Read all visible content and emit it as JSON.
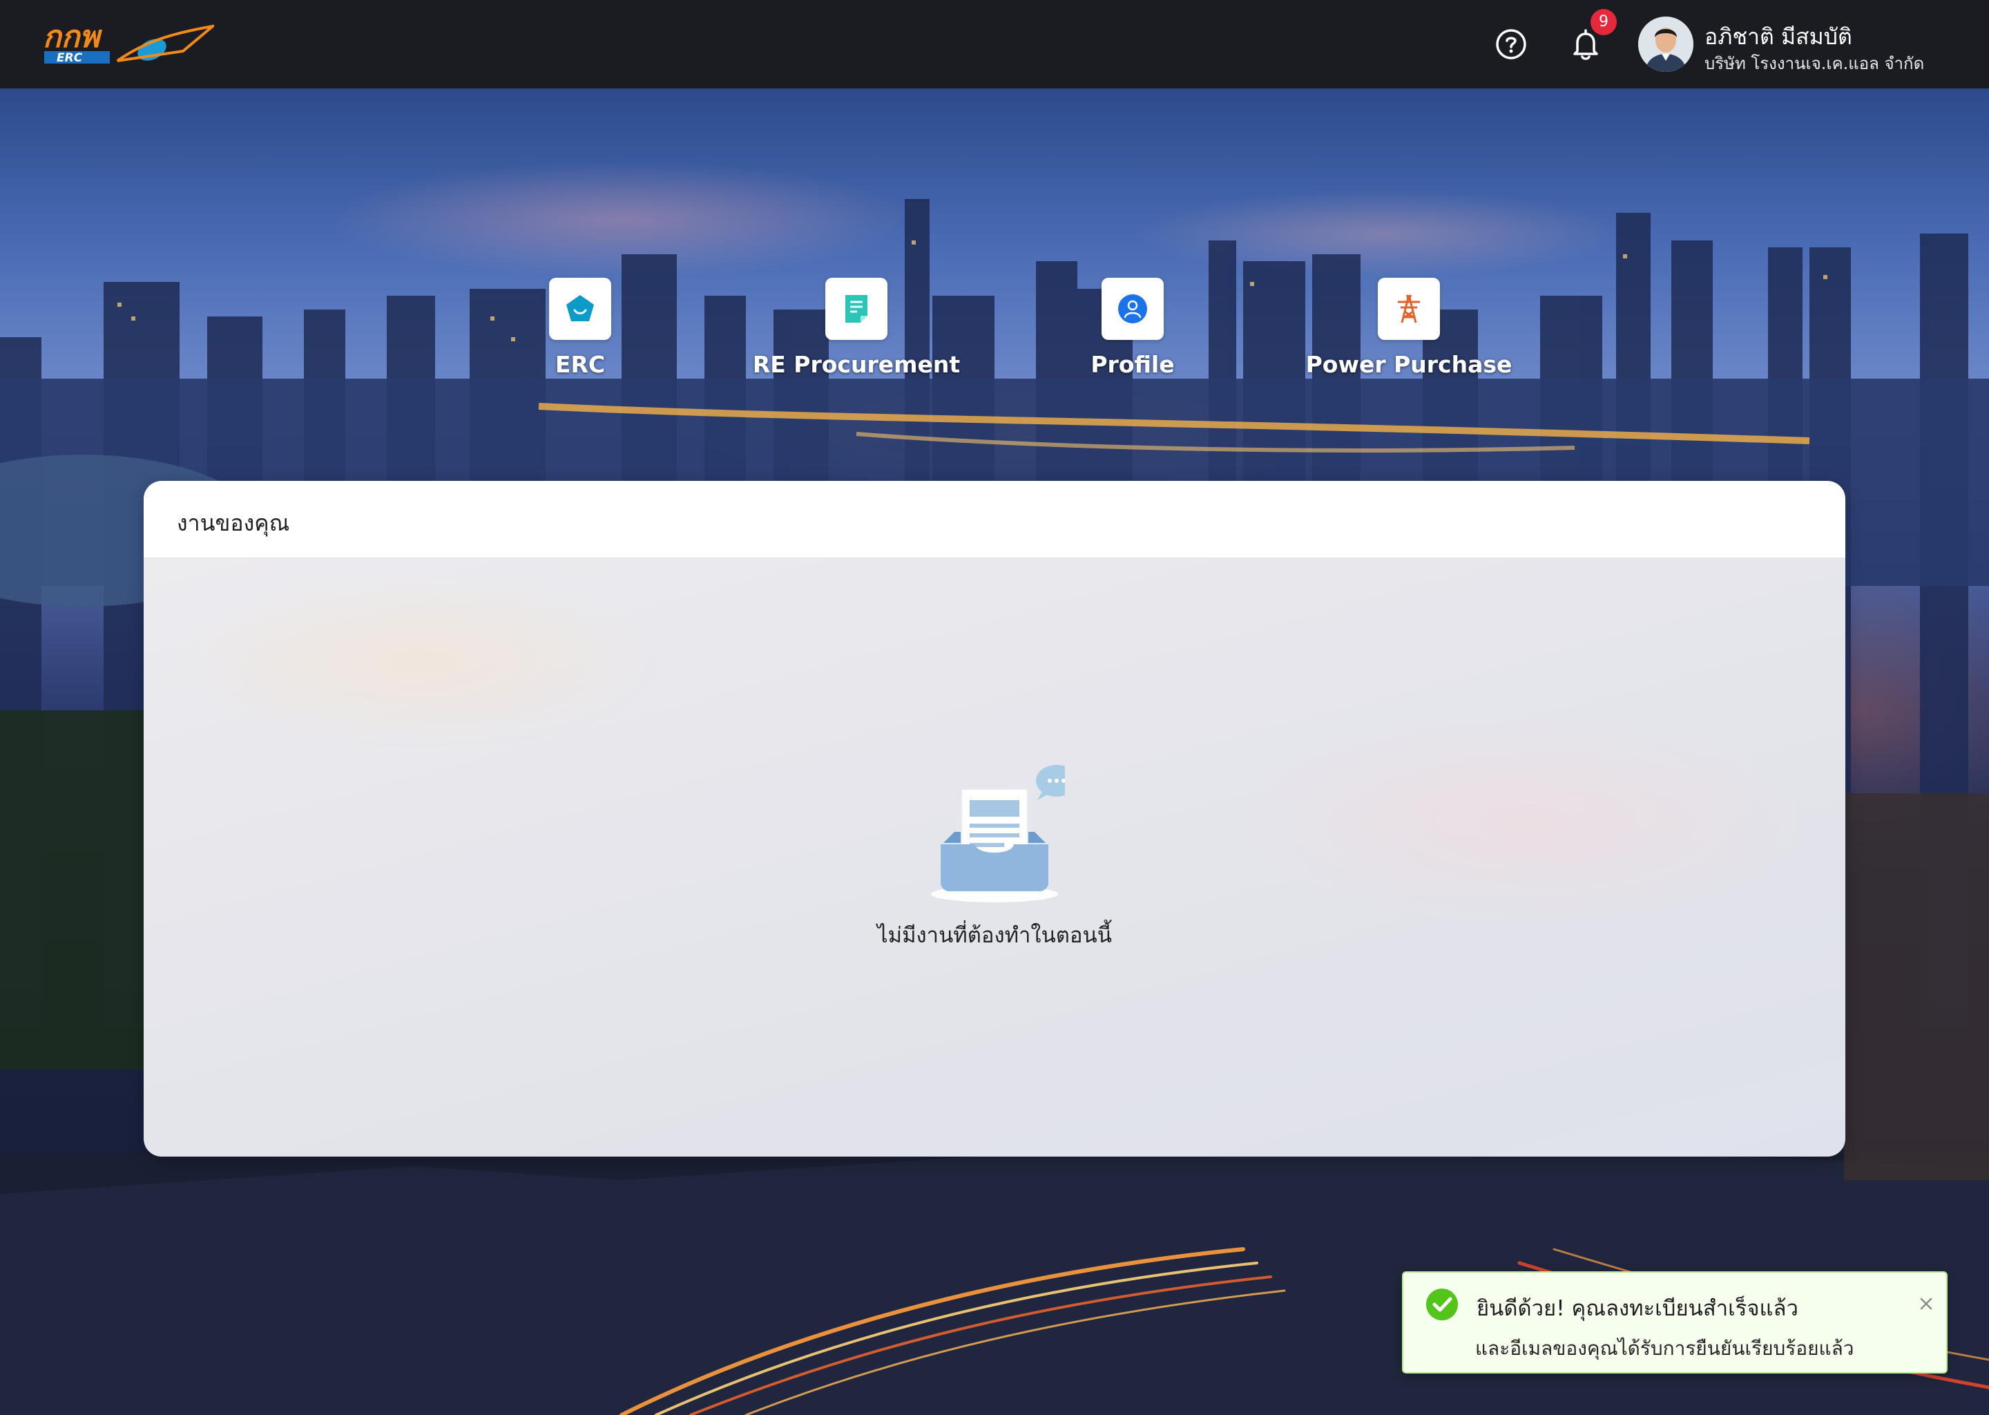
{
  "header": {
    "logo_text": "กกพ ERC",
    "help_icon": "question-circle-icon",
    "notification_icon": "bell-icon",
    "notification_count": "9",
    "user": {
      "name": "อภิชาติ มีสมบัติ",
      "company": "บริษัท โรงงานเจ.เค.แอล จำกัด"
    }
  },
  "apps": [
    {
      "label": "ERC",
      "icon": "erc-pentagon-icon",
      "color": "#0b9bc6"
    },
    {
      "label": "RE Procurement",
      "icon": "document-icon",
      "color": "#2cc4b6"
    },
    {
      "label": "Profile",
      "icon": "user-circle-icon",
      "color": "#1a73e8"
    },
    {
      "label": "Power Purchase",
      "icon": "transmission-tower-icon",
      "color": "#e2622c"
    }
  ],
  "tasks": {
    "title": "งานของคุณ",
    "empty_icon": "empty-inbox-icon",
    "empty_message": "ไม่มีงานที่ต้องทำในตอนนี้"
  },
  "toast": {
    "icon": "check-circle-icon",
    "title": "ยินดีด้วย! คุณลงทะเบียนสำเร็จแล้ว",
    "description": "และอีเมลของคุณได้รับการยืนยันเรียบร้อยแล้ว",
    "close_icon": "close-icon",
    "status_color": "#52c41a"
  }
}
